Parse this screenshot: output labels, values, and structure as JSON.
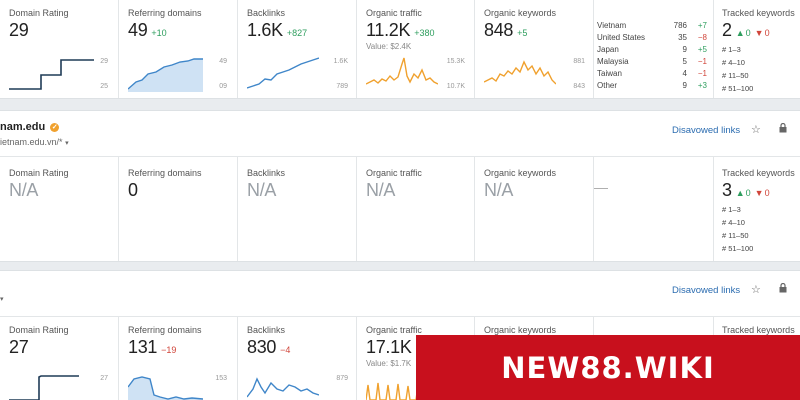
{
  "row1": {
    "domain_rating": {
      "label": "Domain Rating",
      "value": "29",
      "axis_top": "29",
      "axis_bottom": "25"
    },
    "referring_domains": {
      "label": "Referring domains",
      "value": "49",
      "delta": "+10",
      "axis_top": "49",
      "axis_bottom": "09"
    },
    "backlinks": {
      "label": "Backlinks",
      "value": "1.6K",
      "delta": "+827",
      "axis_top": "1.6K",
      "axis_bottom": "789"
    },
    "organic_traffic": {
      "label": "Organic traffic",
      "value": "11.2K",
      "delta": "+380",
      "sub": "Value: $2.4K",
      "axis_top": "15.3K",
      "axis_bottom": "10.7K"
    },
    "organic_keywords": {
      "label": "Organic keywords",
      "value": "848",
      "delta": "+5",
      "axis_top": "881",
      "axis_bottom": "843"
    },
    "countries": [
      {
        "name": "Vietnam",
        "count": "786",
        "delta": "+7",
        "dir": "up"
      },
      {
        "name": "United States",
        "count": "35",
        "delta": "−8",
        "dir": "down"
      },
      {
        "name": "Japan",
        "count": "9",
        "delta": "+5",
        "dir": "up"
      },
      {
        "name": "Malaysia",
        "count": "5",
        "delta": "−1",
        "dir": "down"
      },
      {
        "name": "Taiwan",
        "count": "4",
        "delta": "−1",
        "dir": "down"
      },
      {
        "name": "Other",
        "count": "9",
        "delta": "+3",
        "dir": "up"
      }
    ],
    "tracked": {
      "label": "Tracked keywords",
      "value": "2",
      "up": "0",
      "down": "0",
      "buckets": [
        "# 1–3",
        "# 4–10",
        "# 11–50",
        "# 51–100"
      ]
    }
  },
  "row2": {
    "domain": "nam.edu",
    "url": "ietnam.edu.vn/*",
    "disavow_label": "Disavowed links",
    "domain_rating": {
      "label": "Domain Rating",
      "value": "N/A"
    },
    "referring_domains": {
      "label": "Referring domains",
      "value": "0"
    },
    "backlinks": {
      "label": "Backlinks",
      "value": "N/A"
    },
    "organic_traffic": {
      "label": "Organic traffic",
      "value": "N/A"
    },
    "organic_keywords": {
      "label": "Organic keywords",
      "value": "N/A"
    },
    "countries_dash": "—",
    "tracked": {
      "label": "Tracked keywords",
      "value": "3",
      "up": "0",
      "down": "0",
      "buckets": [
        "# 1–3",
        "# 4–10",
        "# 11–50",
        "# 51–100"
      ]
    }
  },
  "row3": {
    "disavow_label": "Disavowed links",
    "domain_rating": {
      "label": "Domain Rating",
      "value": "27",
      "axis_top": "27"
    },
    "referring_domains": {
      "label": "Referring domains",
      "value": "131",
      "delta": "−19",
      "axis_top": "153"
    },
    "backlinks": {
      "label": "Backlinks",
      "value": "830",
      "delta": "−4",
      "axis_top": "879"
    },
    "organic_traffic": {
      "label": "Organic traffic",
      "value": "17.1K",
      "sub": "Value: $1.7K"
    },
    "organic_keywords": {
      "label": "Organic keywords"
    },
    "tracked": {
      "label": "Tracked keywords"
    }
  },
  "banner": {
    "text": "NEW88.WIKI"
  },
  "colors": {
    "dark_line": "#1f3b57",
    "blue_line": "#3f86c9",
    "blue_fill": "#cfe2f4",
    "orange_line": "#f0a12e",
    "up": "#2e9e5e",
    "down": "#d0453a",
    "banner": "#c8101d"
  }
}
